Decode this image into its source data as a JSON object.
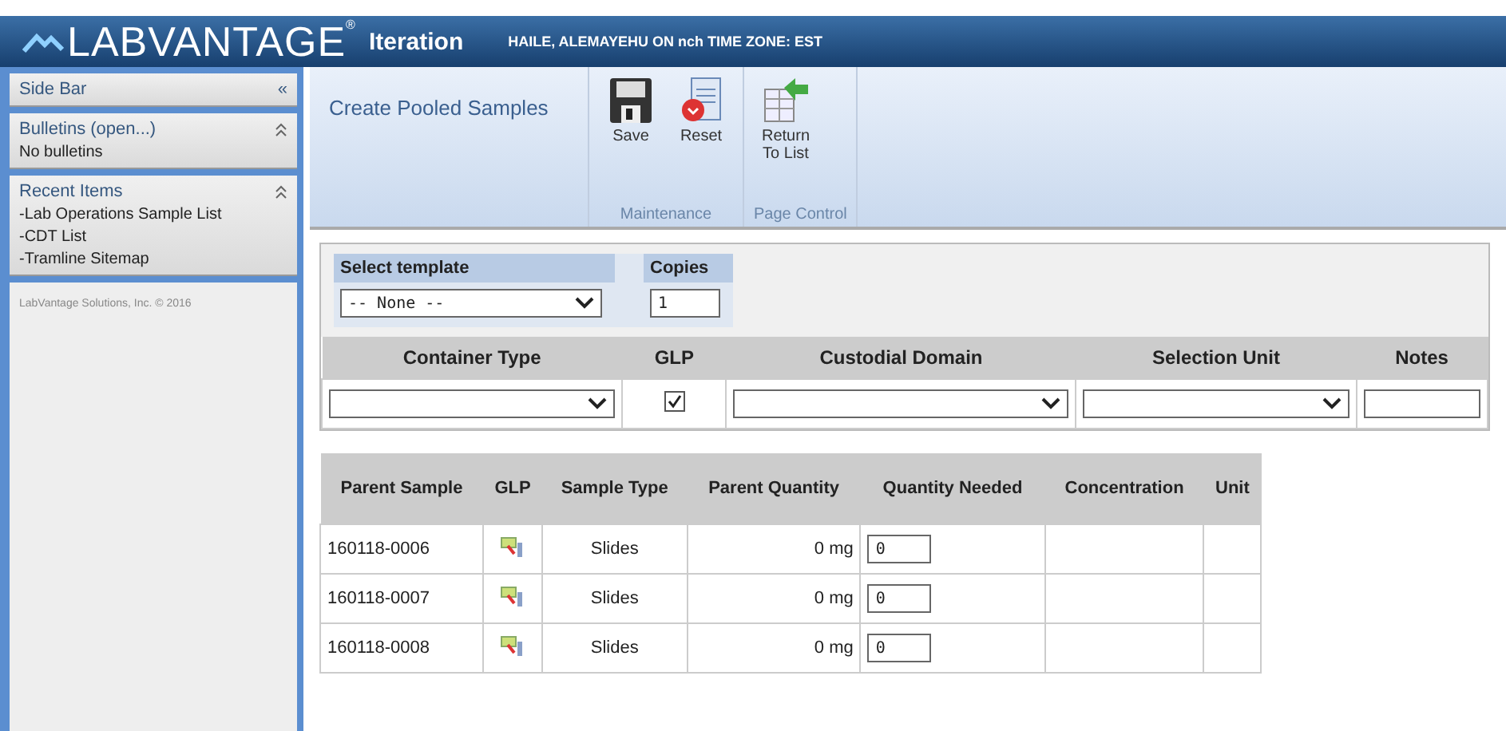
{
  "header": {
    "logo": "LABVANTAGE",
    "logo_mark": "®",
    "app": "Iteration",
    "user": "HAILE, ALEMAYEHU ON nch TIME ZONE: EST"
  },
  "sidebar": {
    "title": "Side Bar",
    "collapse": "«",
    "panels": [
      {
        "title": "Bulletins (open...)",
        "items": [
          "No bulletins"
        ]
      },
      {
        "title": "Recent Items",
        "items": [
          "-Lab Operations Sample List",
          "-CDT List",
          "-Tramline Sitemap"
        ]
      }
    ],
    "footer": "LabVantage Solutions, Inc. © 2016"
  },
  "toolbar": {
    "page_title": "Create Pooled Samples",
    "groups": [
      {
        "label": "Maintenance",
        "buttons": [
          {
            "label": "Save",
            "kind": "save"
          },
          {
            "label": "Reset",
            "kind": "reset"
          }
        ]
      },
      {
        "label": "Page Control",
        "buttons": [
          {
            "label": "Return To List",
            "kind": "return"
          }
        ]
      }
    ]
  },
  "template": {
    "label": "Select template",
    "value": "-- None --",
    "copies_label": "Copies",
    "copies": "1"
  },
  "details": {
    "columns": [
      "Container Type",
      "GLP",
      "Custodial Domain",
      "Selection Unit",
      "Notes"
    ],
    "glp_checked": true
  },
  "table": {
    "columns": [
      "Parent Sample",
      "GLP",
      "Sample Type",
      "Parent Quantity",
      "Quantity Needed",
      "Concentration",
      "Unit"
    ],
    "rows": [
      {
        "parent_sample": "160118-0006",
        "sample_type": "Slides",
        "parent_quantity": "0 mg",
        "quantity_needed": "0"
      },
      {
        "parent_sample": "160118-0007",
        "sample_type": "Slides",
        "parent_quantity": "0 mg",
        "quantity_needed": "0"
      },
      {
        "parent_sample": "160118-0008",
        "sample_type": "Slides",
        "parent_quantity": "0 mg",
        "quantity_needed": "0"
      }
    ]
  }
}
